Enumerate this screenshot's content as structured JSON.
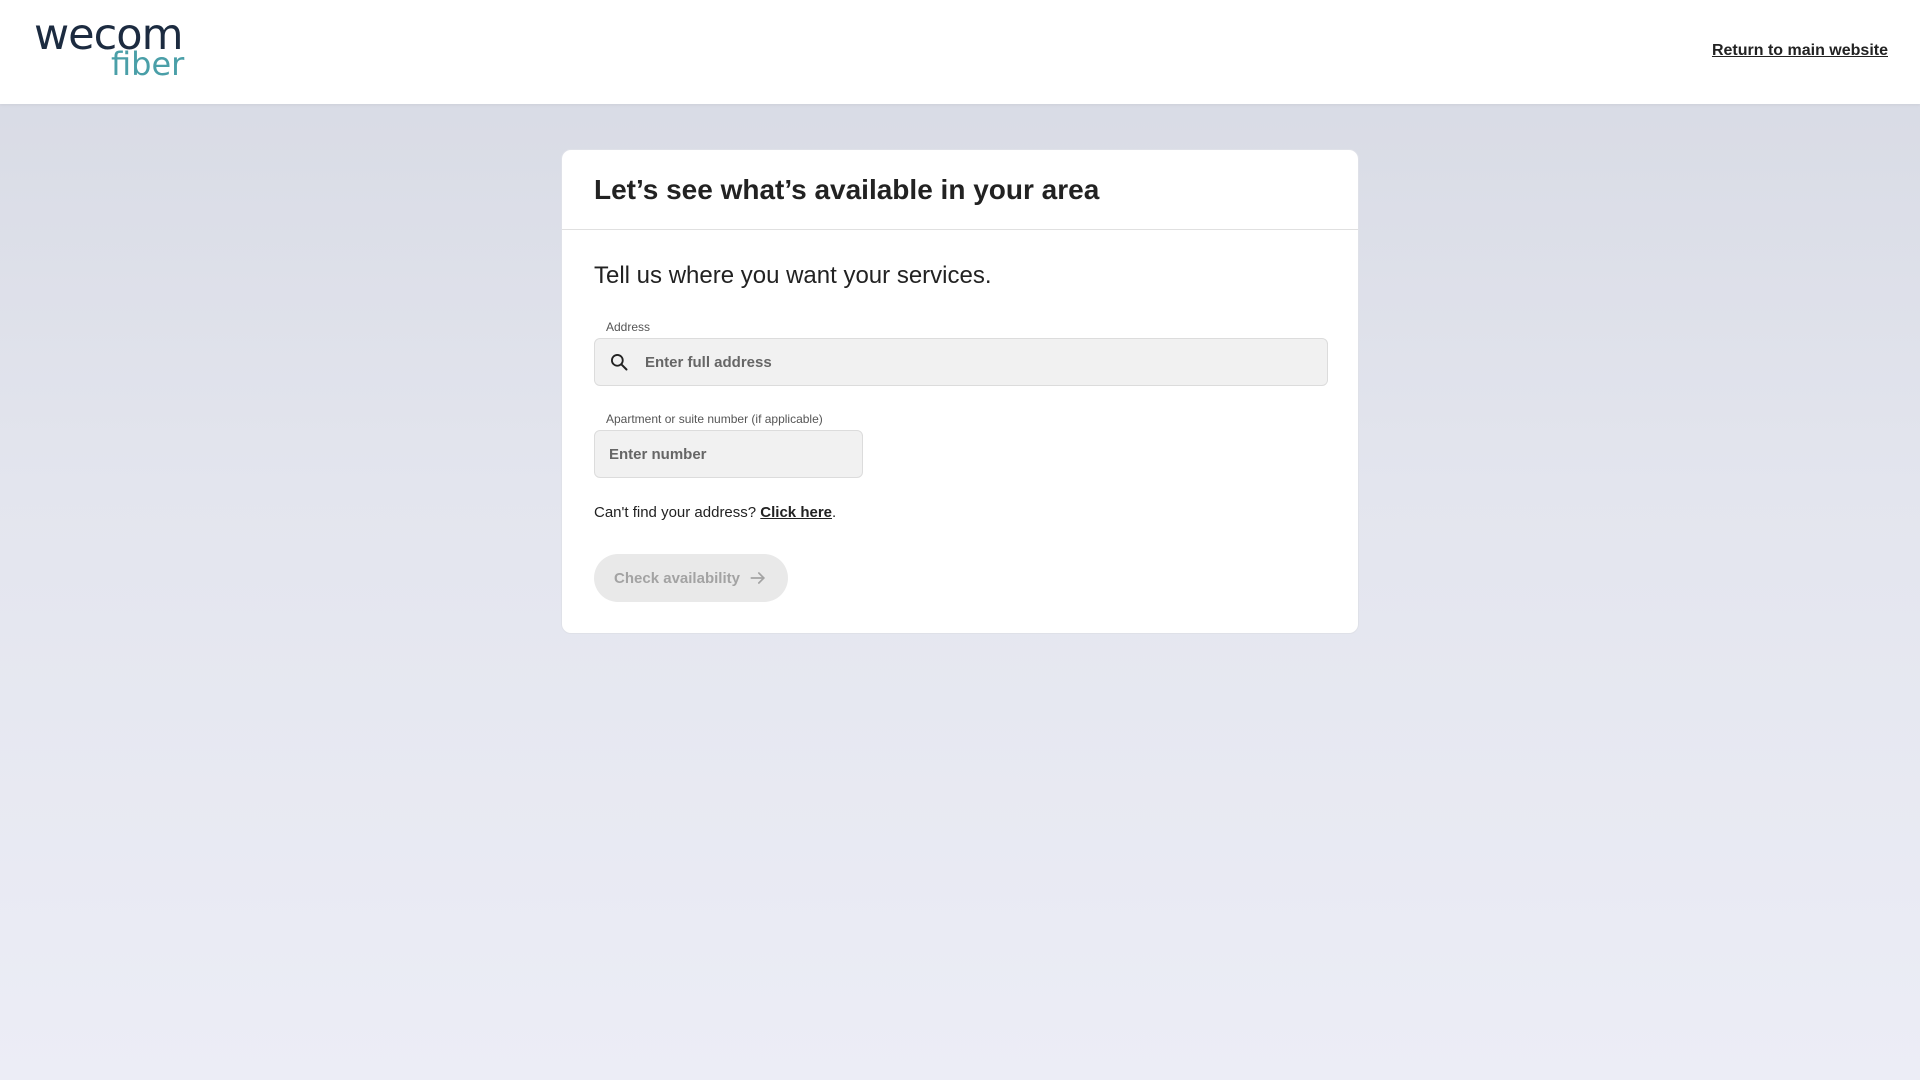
{
  "header": {
    "logo_word": "wecom",
    "logo_sub": "fiber",
    "return_link": "Return to main website"
  },
  "card": {
    "title": "Let’s see what’s available in your area",
    "subtitle": "Tell us where you want your services.",
    "address": {
      "label": "Address",
      "placeholder": "Enter full address",
      "value": ""
    },
    "apartment": {
      "label": "Apartment or suite number (if applicable)",
      "placeholder": "Enter number",
      "value": ""
    },
    "cant_find": {
      "text": "Can't find your address?",
      "link": "Click here",
      "suffix": "."
    },
    "check_button": {
      "label": "Check availability",
      "icon": "arrow-right-icon",
      "state": "disabled"
    }
  },
  "colors": {
    "brand_dark": "#1c2b40",
    "brand_teal": "#4a9fa8",
    "disabled_button_bg": "#e9e9e9",
    "disabled_button_text": "#a3a3a3"
  }
}
